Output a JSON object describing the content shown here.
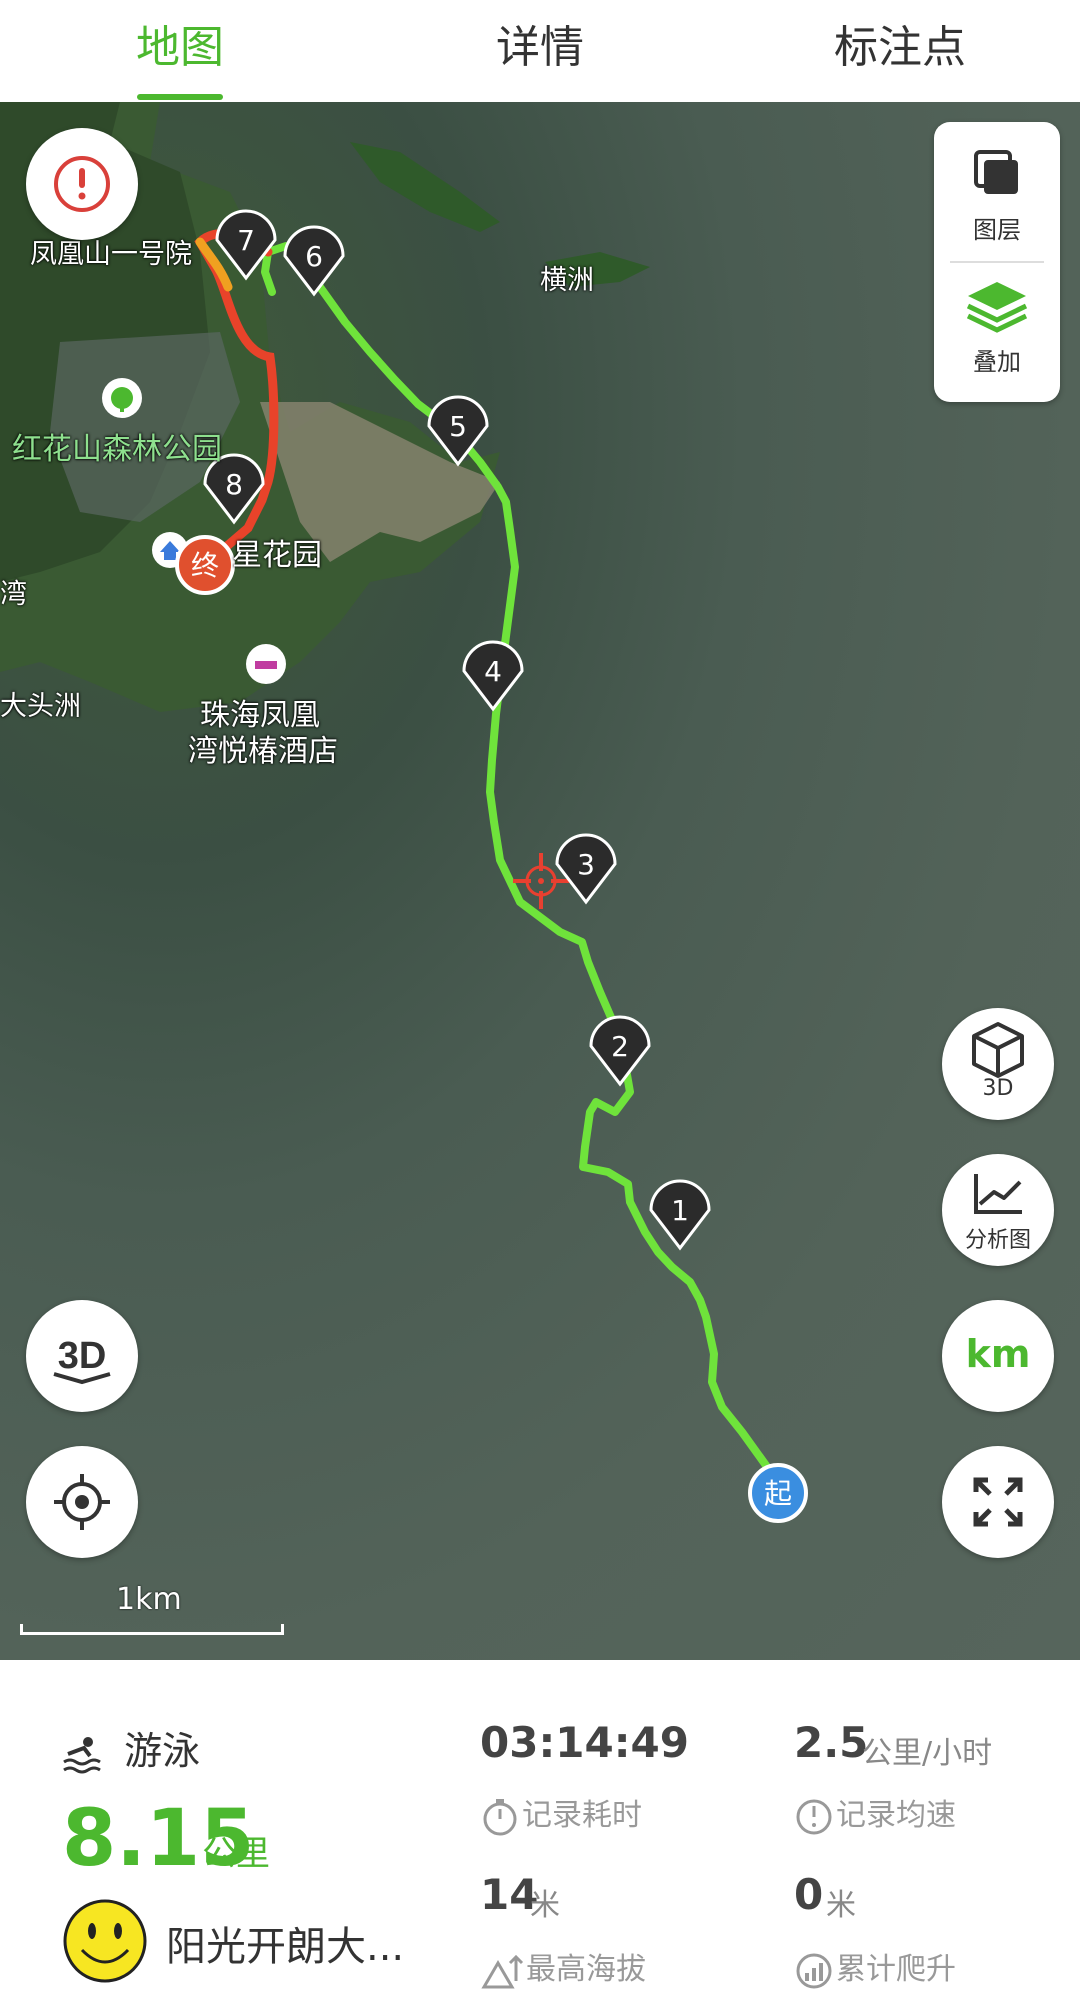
{
  "tabs": [
    {
      "label": "地图",
      "active": true
    },
    {
      "label": "详情",
      "active": false
    },
    {
      "label": "标注点",
      "active": false
    }
  ],
  "map": {
    "place_labels": [
      "凤凰山一号院",
      "红花山森林公园",
      "横洲",
      "星花园",
      "大头洲",
      "珠海凤凰",
      "湾悦椿酒店",
      "湾"
    ],
    "markers": [
      "1",
      "2",
      "3",
      "4",
      "5",
      "6",
      "7",
      "8"
    ],
    "start_label": "起",
    "end_label": "终",
    "layer_label": "图层",
    "overlay_label": "叠加",
    "btn_3d_label": "3D",
    "btn_analysis_label": "分析图",
    "btn_unit_label": "km",
    "scale_label": "1km",
    "accent_green": "#4cb82f",
    "track_green": "#6fe33b"
  },
  "summary": {
    "sport": "游泳",
    "distance": "8.15",
    "distance_unit": "公里",
    "user_name": "阳光开朗大...",
    "duration": "03:14:49",
    "duration_label": "记录耗时",
    "avg_speed": "2.5",
    "avg_speed_unit": "公里/小时",
    "avg_speed_label": "记录均速",
    "max_altitude": "14",
    "max_altitude_unit": "米",
    "max_altitude_label": "最高海拔",
    "total_climb": "0",
    "total_climb_unit": "米",
    "total_climb_label": "累计爬升"
  }
}
